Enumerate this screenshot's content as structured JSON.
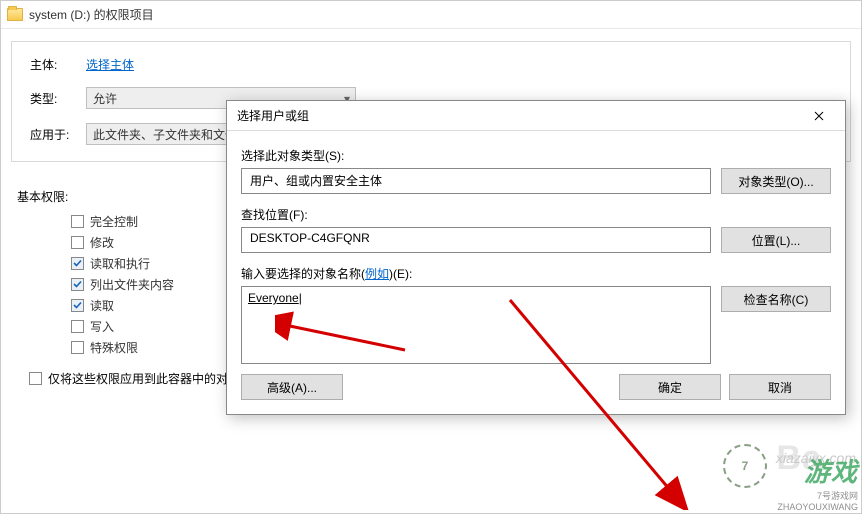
{
  "parent": {
    "title": "system (D:) 的权限项目",
    "principal_label": "主体:",
    "principal_link": "选择主体",
    "type_label": "类型:",
    "type_value": "允许",
    "applies_label": "应用于:",
    "applies_value": "此文件夹、子文件夹和文件",
    "perms_heading": "基本权限:",
    "perms": [
      {
        "label": "完全控制",
        "checked": false
      },
      {
        "label": "修改",
        "checked": false
      },
      {
        "label": "读取和执行",
        "checked": true
      },
      {
        "label": "列出文件夹内容",
        "checked": true
      },
      {
        "label": "读取",
        "checked": true
      },
      {
        "label": "写入",
        "checked": false
      },
      {
        "label": "特殊权限",
        "checked": false
      }
    ],
    "only_apply_label": "仅将这些权限应用到此容器中的对"
  },
  "dialog": {
    "title": "选择用户或组",
    "obj_type_label": "选择此对象类型(S):",
    "obj_type_value": "用户、组或内置安全主体",
    "obj_type_btn": "对象类型(O)...",
    "location_label": "查找位置(F):",
    "location_value": "DESKTOP-C4GFQNR",
    "location_btn": "位置(L)...",
    "name_label_prefix": "输入要选择的对象名称(",
    "name_label_link": "例如",
    "name_label_suffix": ")(E):",
    "name_value": "Everyone",
    "check_btn": "检查名称(C)",
    "advanced_btn": "高级(A)...",
    "ok_btn": "确定",
    "cancel_btn": "取消"
  },
  "watermark": {
    "big": "游戏",
    "sub": "7号游戏网",
    "sub2": "ZHAOYOUXIWANG",
    "url": "xiazaiyx.com",
    "badge": "7"
  }
}
